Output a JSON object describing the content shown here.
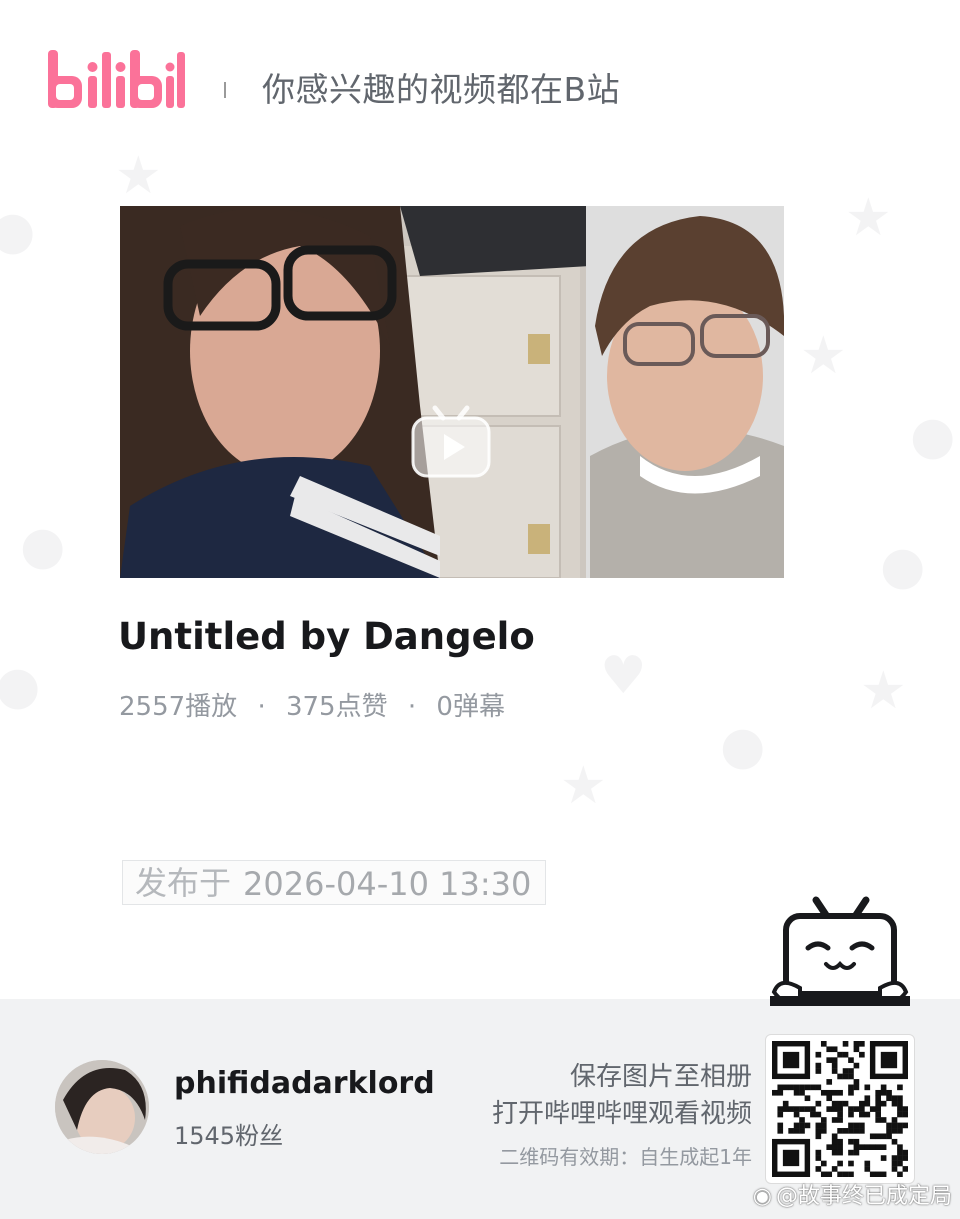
{
  "header": {
    "logo_text": "bilibili",
    "slogan": "你感兴趣的视频都在B站"
  },
  "video": {
    "title": "Untitled by Dangelo",
    "play_count": "2557播放",
    "like_count": "375点赞",
    "danmaku_count": "0弹幕",
    "separator": "·",
    "publish_label": "发布于",
    "publish_time": "2026-04-10 13:30"
  },
  "uploader": {
    "name": "phifidadarklord",
    "fans": "1545粉丝"
  },
  "qr_panel": {
    "save_text": "保存图片至相册",
    "open_text": "打开哔哩哔哩观看视频",
    "validity_text": "二维码有效期：自生成起1年"
  },
  "watermark": {
    "text": "@故事终已成定局"
  },
  "icons": {
    "logo": "bilibili-logo-icon",
    "play": "play-badge-icon",
    "mascot": "tv-mascot-icon",
    "qr": "qr-code-icon",
    "weibo": "weibo-icon"
  },
  "colors": {
    "brand_pink": "#fb7299",
    "text_main": "#18191c",
    "text_sub": "#61666d",
    "text_light": "#9499a0",
    "footer_bg": "#f1f2f3"
  }
}
